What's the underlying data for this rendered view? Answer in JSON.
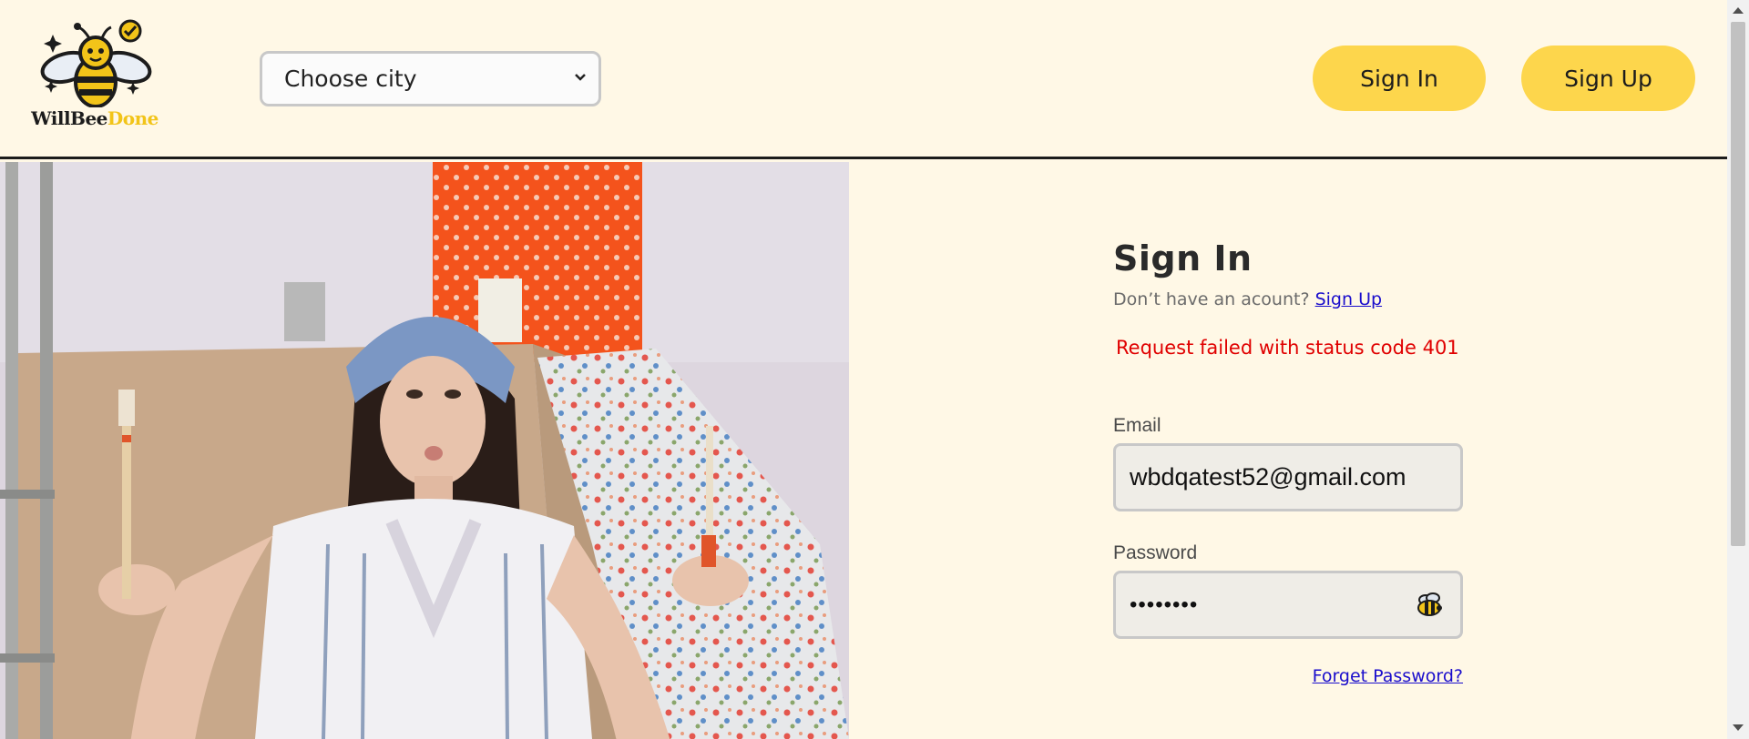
{
  "header": {
    "logo": {
      "name_part1": "WillBee",
      "name_part2": "Done",
      "icon": "bee-with-checkmark-icon"
    },
    "city_select": {
      "selected": "Choose city",
      "icon": "chevron-down-icon"
    },
    "signin_label": "Sign In",
    "signup_label": "Sign Up"
  },
  "hero_image": {
    "description_icon": "woman-with-paintbrushes-photo"
  },
  "form": {
    "title": "Sign In",
    "no_account_text": "Don’t have an acount?",
    "signup_link": "Sign Up",
    "error_message": "Request failed with status code 401",
    "email_label": "Email",
    "email_value": "wbdqatest52@gmail.com",
    "password_label": "Password",
    "password_value": "••••••••",
    "password_toggle_icon": "bee-icon",
    "forgot_link": "Forget Password?"
  },
  "colors": {
    "background": "#fff8e6",
    "accent_yellow": "#fdd64c",
    "error": "#e00000",
    "link": "#1a0dcc"
  }
}
